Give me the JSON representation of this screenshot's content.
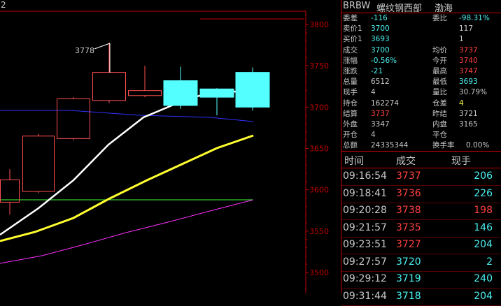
{
  "chart": {
    "axis_labels": [
      "3800",
      "3750",
      "3700",
      "3650",
      "3600",
      "3550",
      "3500"
    ],
    "corner_label": "2",
    "annotation": "3778",
    "colors": {
      "up": "#ff5050",
      "down": "#54ffff",
      "ma_white": "#ffffff",
      "ma_yellow": "#ffff30",
      "ma_blue": "#3030ff",
      "ma_green": "#40ff40",
      "ma_magenta": "#ff30ff",
      "axis": "#c00000"
    }
  },
  "chart_data": {
    "type": "candlestick",
    "y_axis": {
      "ticks": [
        3800,
        3750,
        3700,
        3650,
        3600,
        3550,
        3500
      ]
    },
    "candles": [
      {
        "open": 3585,
        "close": 3612,
        "high": 3625,
        "low": 3570
      },
      {
        "open": 3598,
        "close": 3665,
        "high": 3668,
        "low": 3596
      },
      {
        "open": 3662,
        "close": 3710,
        "high": 3712,
        "low": 3660
      },
      {
        "open": 3708,
        "close": 3742,
        "high": 3778,
        "low": 3705
      },
      {
        "open": 3714,
        "close": 3720,
        "high": 3750,
        "low": 3712
      },
      {
        "open": 3732,
        "close": 3702,
        "high": 3749,
        "low": 3698
      },
      {
        "open": 3722,
        "close": 3712,
        "high": 3723,
        "low": 3690
      },
      {
        "open": 3742,
        "close": 3700,
        "high": 3748,
        "low": 3696
      }
    ],
    "annotated_high": 3778
  },
  "panel": {
    "header": {
      "code": "BRBW",
      "name": "螺纹钢西部",
      "exchange": "渤海"
    },
    "quote": {
      "委差": "-116",
      "委比": "-98.31%",
      "卖价1": "3700",
      "卖量1": "117",
      "买价1": "3693",
      "买量1": "1",
      "成交": "3700",
      "均价": "3737",
      "涨幅": "-0.56%",
      "今开": "3740",
      "涨跌": "-21",
      "最高": "3747",
      "总量": "6512",
      "最低": "3693",
      "现手": "4",
      "量比": "30.79%",
      "持仓": "162274",
      "仓差": "4",
      "结算": "3737",
      "昨结": "3721",
      "外盘": "3347",
      "内盘": "3165",
      "开仓": "4",
      "平仓": "",
      "总额": "24335344",
      "换手率": "0.00%"
    },
    "ticks_header": {
      "time": "时间",
      "price": "成交",
      "volume": "现手"
    },
    "ticks": [
      {
        "time": "09:16:54",
        "price": "3737",
        "volume": "206",
        "pc": "red",
        "vc": "cyan"
      },
      {
        "time": "09:18:41",
        "price": "3736",
        "volume": "226",
        "pc": "red",
        "vc": "cyan"
      },
      {
        "time": "09:20:28",
        "price": "3738",
        "volume": "198",
        "pc": "red",
        "vc": "red"
      },
      {
        "time": "09:21:57",
        "price": "3735",
        "volume": "146",
        "pc": "red",
        "vc": "cyan"
      },
      {
        "time": "09:23:51",
        "price": "3727",
        "volume": "204",
        "pc": "red",
        "vc": "cyan"
      },
      {
        "time": "09:27:57",
        "price": "3720",
        "volume": "2",
        "pc": "cyan",
        "vc": "cyan"
      },
      {
        "time": "09:29:12",
        "price": "3719",
        "volume": "240",
        "pc": "cyan",
        "vc": "cyan"
      },
      {
        "time": "09:31:44",
        "price": "3718",
        "volume": "204",
        "pc": "cyan",
        "vc": "cyan"
      }
    ]
  }
}
